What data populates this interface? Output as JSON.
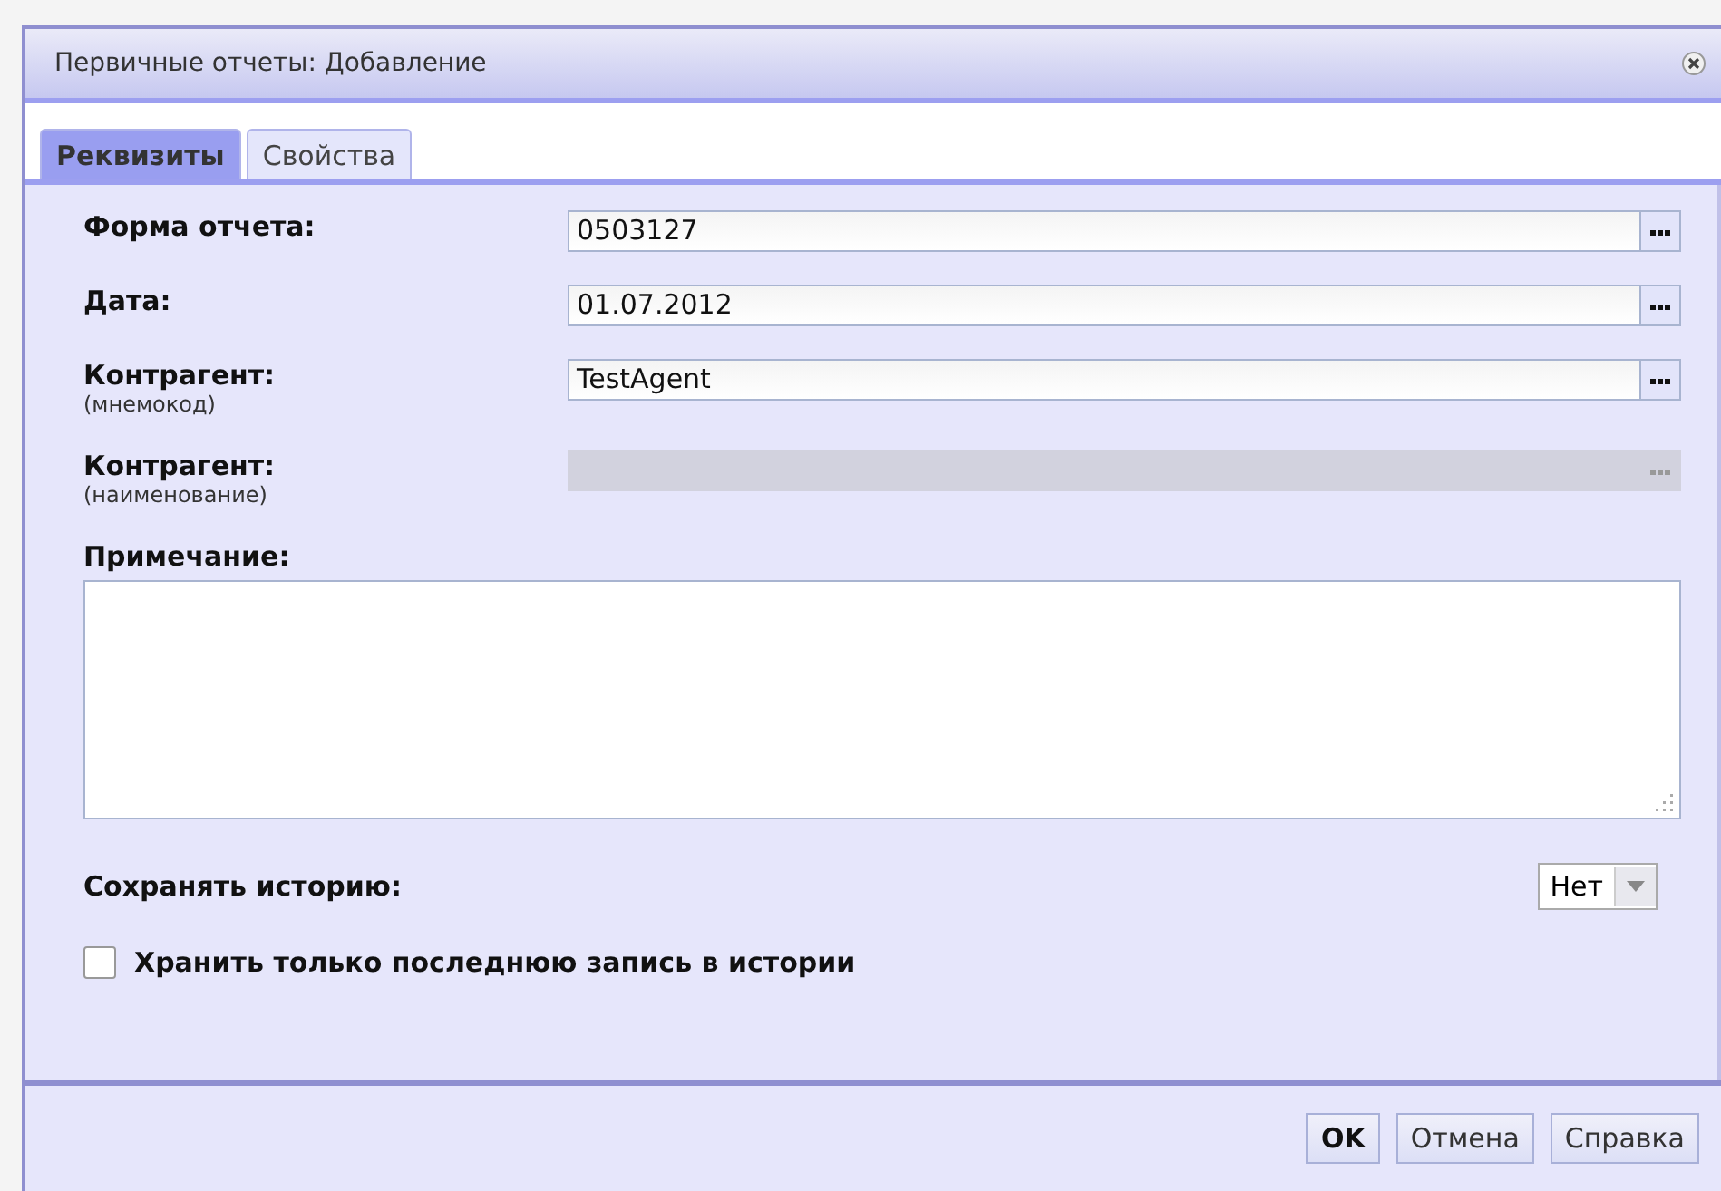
{
  "window": {
    "title": "Первичные отчеты: Добавление"
  },
  "tabs": [
    {
      "label": "Реквизиты",
      "selected": true
    },
    {
      "label": "Свойства",
      "selected": false
    }
  ],
  "fields": [
    {
      "label": "Форма отчета:",
      "value": "0503127",
      "disabled": false
    },
    {
      "label": "Дата:",
      "value": "01.07.2012",
      "disabled": false
    },
    {
      "label": "Контрагент:",
      "hint": "(мнемокод)",
      "value": "TestAgent",
      "disabled": false
    },
    {
      "label": "Контрагент:",
      "hint": "(наименование)",
      "disabled": true
    }
  ],
  "note": {
    "label": "Примечание:"
  },
  "history": {
    "label": "Сохранять историю:",
    "value": "Нет"
  },
  "keep_last": {
    "label": "Хранить только последнюю запись в истории",
    "checked": false
  },
  "buttons": [
    {
      "label": "OK",
      "default": true
    },
    {
      "label": "Отмена",
      "default": false
    },
    {
      "label": "Справка",
      "default": false
    }
  ]
}
